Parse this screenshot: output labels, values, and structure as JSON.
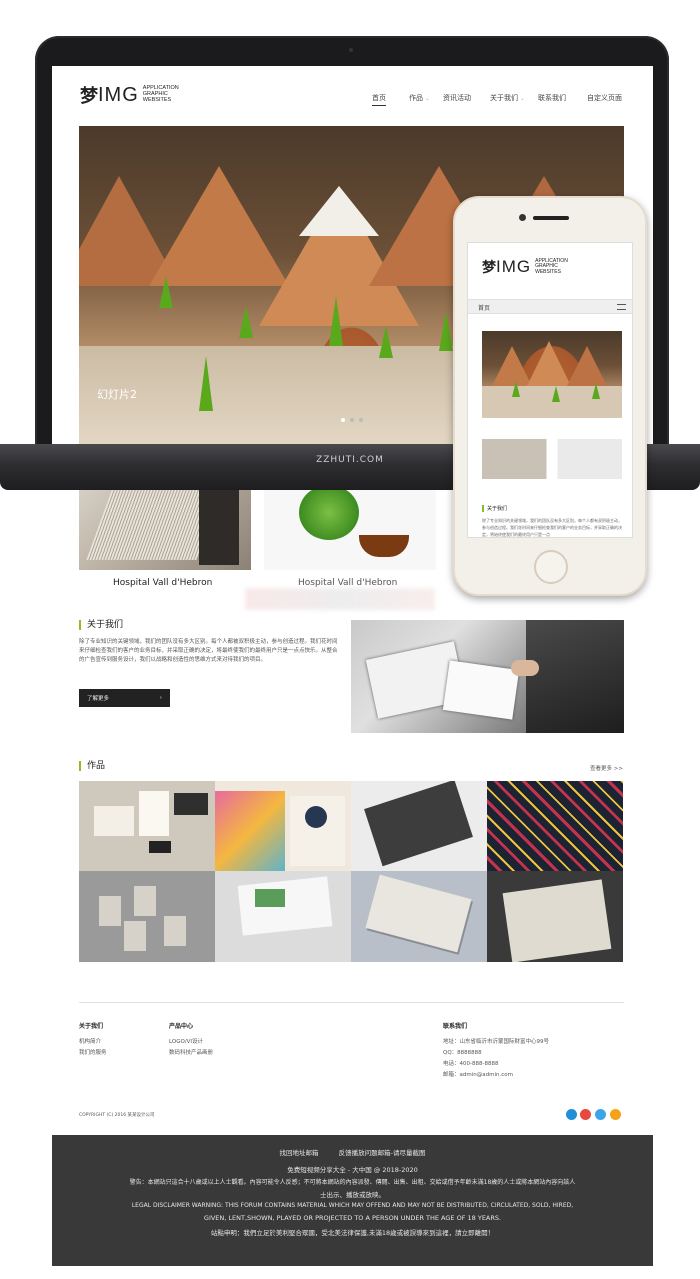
{
  "laptop": {
    "logo": {
      "mark": "梦",
      "big": "IMG",
      "line1": "APPLICATION",
      "line2": "GRAPHIC",
      "line3": "WEBSITES"
    },
    "nav": [
      "首页",
      "作品",
      "资讯活动",
      "关于我们",
      "联系我们",
      "自定义页面"
    ],
    "slide_caption": "幻灯片2",
    "brand_label": "ZZHUTI.COM"
  },
  "phone": {
    "logo": {
      "mark": "梦",
      "big": "IMG",
      "line1": "APPLICATION",
      "line2": "GRAPHIC",
      "line3": "WEBSITES"
    },
    "menu_label": "首页",
    "about_title": "关于我们",
    "about_text": "除了专业知识的关键领域，我们的团队没有多大区别。每个人都有双积极主动，参与创造过程。我们花时间来仔细检查我们的客户的业务目标，并采取正确的决定，将始终使我们的最终用户只是一点"
  },
  "captions": {
    "item1": "Hospital Vall d'Hebron",
    "item2": "Hospital Vall d'Hebron"
  },
  "about": {
    "title": "关于我们",
    "text": "除了专业知识的关键领域，我们的团队没有多大区别。每个人都被双积极主动，参与创造过程。我们花时间来仔细检查我们的客户的业务目标，并采取正确的决定，将最终使我们的最终用户只是一点点快乐。从整合的广告宣传到服务设计，我们以战略和创造性的思维方式来对待我们的项目。",
    "button_label": "了解更多",
    "button_arrow": "›"
  },
  "works": {
    "title": "作品",
    "more": "查看更多 >>"
  },
  "footer": {
    "col1": {
      "title": "关于我们",
      "items": [
        "机构简介",
        "我们的服务"
      ]
    },
    "col2": {
      "title": "产品中心",
      "items": [
        "LOGO/VI设计",
        "数码科技产品画册"
      ]
    },
    "col3": {
      "title": "联系我们",
      "items": [
        "地址：山东省临沂市沂蒙国际财富中心99号",
        "QQ：8888888",
        "电话：400-888-8888",
        "邮箱：admin@admin.com"
      ]
    },
    "copyright": "COPYRIGHT (C) 2016 某某设计公司",
    "social_colors": [
      "#1e90d6",
      "#e8483d",
      "#3aa6e8",
      "#f5a21a"
    ]
  },
  "bottom": {
    "links": [
      "找回地址邮箱",
      "反馈播放问题邮箱-请尽量截图"
    ],
    "line2": "免费短视频分享大全 - 大中国 @ 2018-2020",
    "line3": "警告：本網站只這合十八歲或以上人士觀看。內容可能令人反感；不可將本網站的內容派發、傳閱、出售、出租、交給或借予年齡未滿18歲的人士或將本網站內容向該人",
    "line4": "士出示、播放或放映。",
    "line5": "LEGAL DISCLAIMER WARNING: THIS FORUM CONTAINS MATERIAL WHICH MAY OFFEND AND MAY NOT BE DISTRIBUTED, CIRCULATED, SOLD, HIRED,",
    "line6": "GIVEN, LENT,SHOWN, PLAYED OR PROJECTED TO A PERSON UNDER THE AGE OF 18 YEARS.",
    "line7": "站點申明：我們立足於美利堅合眾國，受北美法律保護,未滿18歲或被誤導來到這裡，請立即離開！"
  }
}
